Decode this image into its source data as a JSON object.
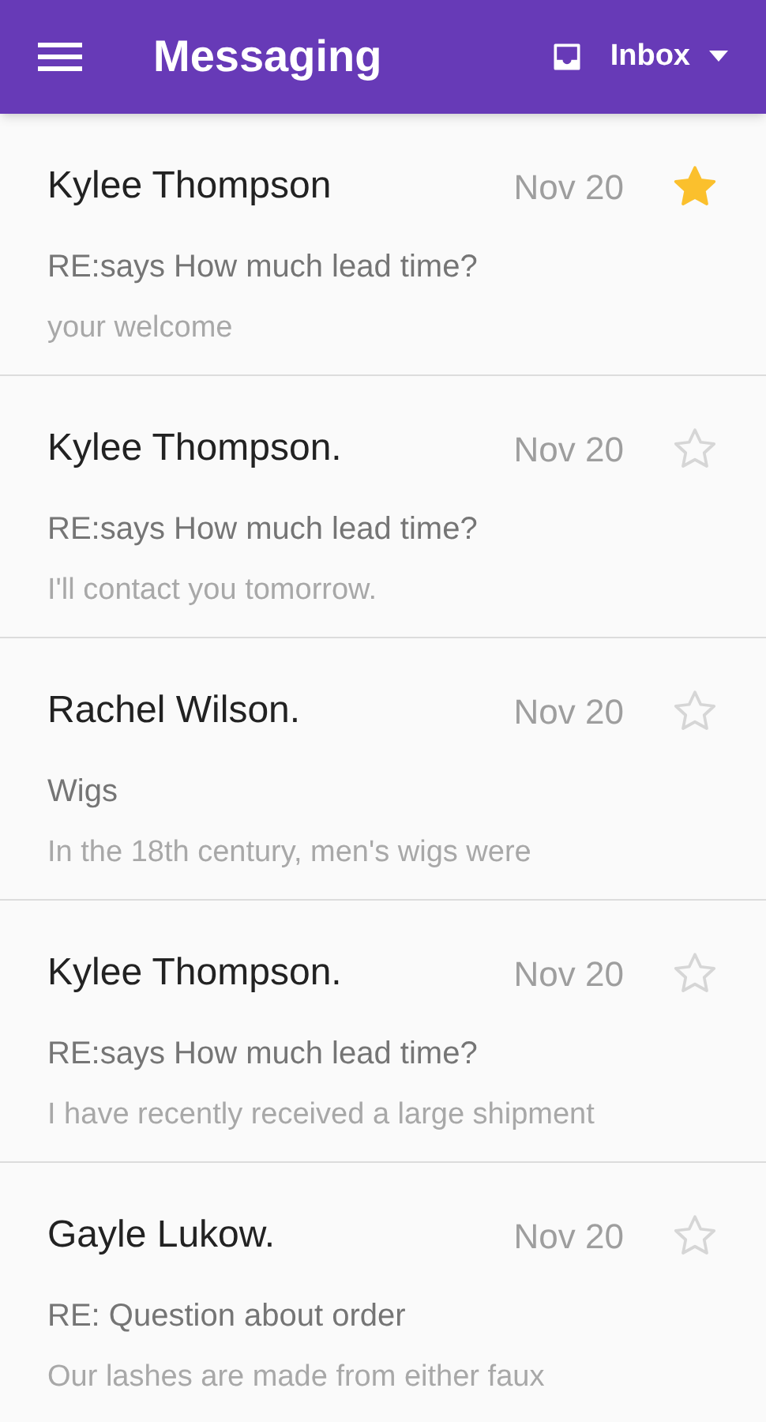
{
  "app_bar": {
    "title": "Messaging",
    "folder": "Inbox"
  },
  "messages": [
    {
      "sender": "Kylee Thompson",
      "date": "Nov 20",
      "subject": "RE:says How much lead time?",
      "preview": "your welcome",
      "starred": true
    },
    {
      "sender": "Kylee Thompson.",
      "date": "Nov 20",
      "subject": "RE:says How much lead time?",
      "preview": "I'll contact you tomorrow.",
      "starred": false
    },
    {
      "sender": "Rachel Wilson.",
      "date": "Nov 20",
      "subject": "Wigs",
      "preview": "In the 18th century, men's wigs were",
      "starred": false
    },
    {
      "sender": "Kylee Thompson.",
      "date": "Nov 20",
      "subject": "RE:says How much lead time?",
      "preview": "I have recently received a large shipment",
      "starred": false
    },
    {
      "sender": "Gayle Lukow.",
      "date": "Nov 20",
      "subject": "RE: Question about order",
      "preview": "Our lashes are made from either faux",
      "starred": false
    }
  ]
}
